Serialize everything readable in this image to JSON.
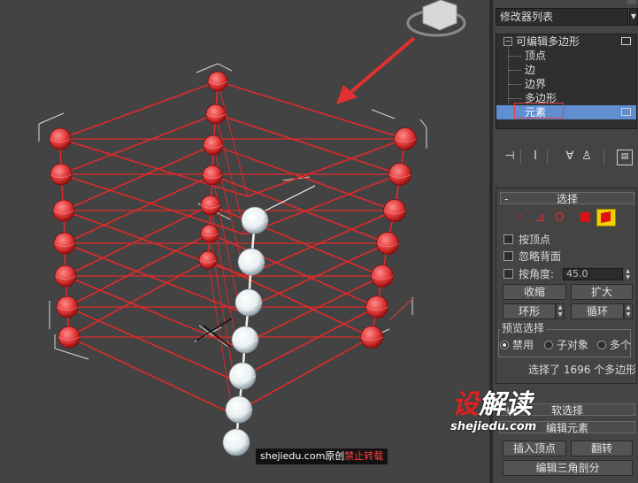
{
  "modifier_list": {
    "label": "修改器列表"
  },
  "stack": {
    "root": "可编辑多边形",
    "items": [
      "顶点",
      "边",
      "边界",
      "多边形",
      "元素"
    ],
    "selected_index": 4
  },
  "toolbar": {
    "icons": [
      "pin-stack-icon",
      "show-end-result-icon",
      "make-unique-icon",
      "remove-modifier-icon",
      "configure-modifier-sets-icon"
    ]
  },
  "selection_rollout": {
    "title": "选择",
    "collapse": "-",
    "subobject_icons": [
      "vertex-icon",
      "edge-icon",
      "border-icon",
      "polygon-icon",
      "element-icon"
    ],
    "by_vertex": "按顶点",
    "ignore_backfacing": "忽略背面",
    "by_angle": "按角度:",
    "angle_value": "45.0",
    "shrink": "收缩",
    "grow": "扩大",
    "ring": "环形",
    "loop": "循环",
    "preview_title": "预览选择",
    "preview_options": [
      "禁用",
      "子对象",
      "多个"
    ],
    "preview_selected": 0,
    "selection_info": "选择了 1696 个多边形"
  },
  "soft_selection": {
    "title": "软选择",
    "collapse": "+"
  },
  "edit_elements": {
    "title": "编辑元素",
    "collapse": "-"
  },
  "edit_element_buttons": {
    "insert_vertex": "插入顶点",
    "flip": "翻转",
    "edit_triangulation": "编辑三角剖分"
  },
  "watermark": {
    "logo_a": "设",
    "logo_b": "解读",
    "url": "shejiedu.com",
    "credit_prefix": "shejiedu.com原创",
    "credit_warning": "禁止转载"
  },
  "colors": {
    "viewport_bg": "#434343",
    "panel_bg": "#444444",
    "selected_row": "#5f8fd1",
    "wire_red": "#e02a2a",
    "sphere_red": "#e03a3a",
    "sphere_white": "#e8eef0",
    "arrow_red": "#e03030",
    "element_button": "#f0d000"
  }
}
